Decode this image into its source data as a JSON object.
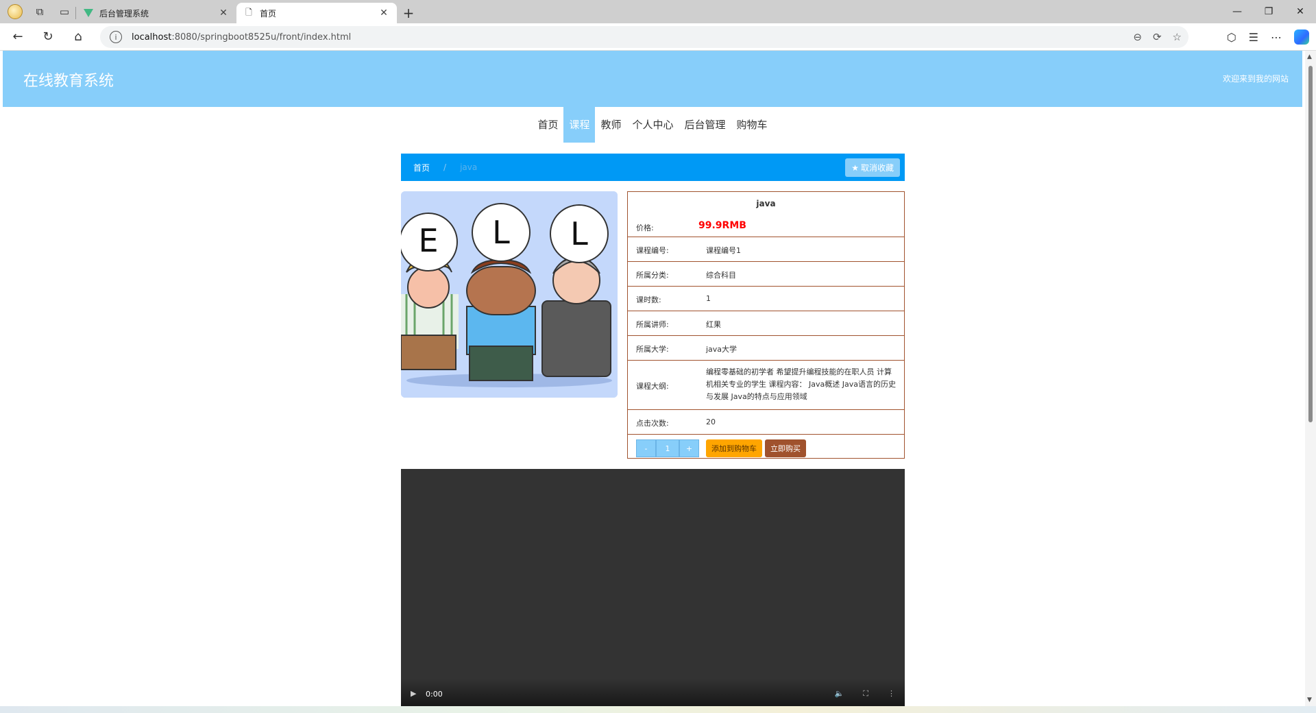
{
  "browser": {
    "tabs": [
      {
        "title": "后台管理系统",
        "active": false
      },
      {
        "title": "首页",
        "active": true
      }
    ],
    "url_host": "localhost",
    "url_path": ":8080/springboot8525u/front/index.html"
  },
  "header": {
    "site_title": "在线教育系统",
    "welcome": "欢迎来到我的网站"
  },
  "nav": {
    "items": [
      "首页",
      "课程",
      "教师",
      "个人中心",
      "后台管理",
      "购物车"
    ],
    "active_index": 1
  },
  "breadcrumb": {
    "home": "首页",
    "separator": "/",
    "current": "java",
    "fav_button": "取消收藏"
  },
  "course": {
    "name": "java",
    "price_label": "价格:",
    "price": "99.9RMB",
    "fields": [
      {
        "label": "课程编号:",
        "value": "课程编号1"
      },
      {
        "label": "所属分类:",
        "value": "综合科目"
      },
      {
        "label": "课时数:",
        "value": "1"
      },
      {
        "label": "所属讲师:",
        "value": "红果"
      },
      {
        "label": "所属大学:",
        "value": "java大学"
      }
    ],
    "outline_label": "课程大纲:",
    "outline": "编程零基础的初学者 希望提升编程技能的在职人员 计算机相关专业的学生 课程内容： Java概述 Java语言的历史与发展 Java的特点与应用领域",
    "clicks_label": "点击次数:",
    "clicks": "20",
    "qty_minus": "-",
    "qty_value": "1",
    "qty_plus": "+",
    "add_cart": "添加到购物车",
    "buy_now": "立即购买",
    "image_letters": [
      "E",
      "L",
      "L"
    ]
  },
  "video": {
    "time": "0:00"
  },
  "colors": {
    "header_bg": "#87cefa",
    "breadcrumb_bg": "#0099f5",
    "price": "#ff0000",
    "border": "#a0522d",
    "cart_btn": "#ffa500",
    "buy_btn": "#a0522d"
  }
}
